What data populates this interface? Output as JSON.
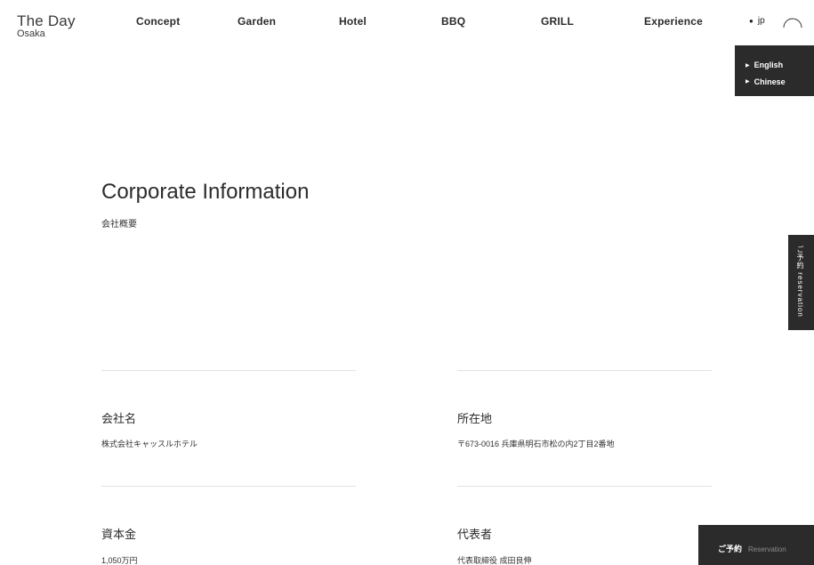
{
  "header": {
    "logo_line1": "The Day",
    "logo_line2": "Osaka",
    "nav": [
      "Concept",
      "Garden",
      "Hotel",
      "BBQ",
      "GRILL",
      "Experience"
    ],
    "lang_current": "jp"
  },
  "lang_menu": {
    "options": [
      "English",
      "Chinese"
    ]
  },
  "side_tab": {
    "label": "ご予約 reservation"
  },
  "page": {
    "title": "Corporate Information",
    "subtitle": "会社概要"
  },
  "info": [
    {
      "label": "会社名",
      "value": "株式会社キャッスルホテル"
    },
    {
      "label": "所在地",
      "value": "〒673-0016 兵庫県明石市松の内2丁目2番地"
    },
    {
      "label": "資本金",
      "value": "1,050万円"
    },
    {
      "label": "代表者",
      "value": "代表取締役 成田良伸"
    }
  ],
  "reservation_bar": {
    "jp": "ご予約",
    "en": "Reservation"
  },
  "colors": {
    "dark_panel": "#2b2b2b",
    "rule": "#e2e2e2",
    "text": "#222222"
  }
}
